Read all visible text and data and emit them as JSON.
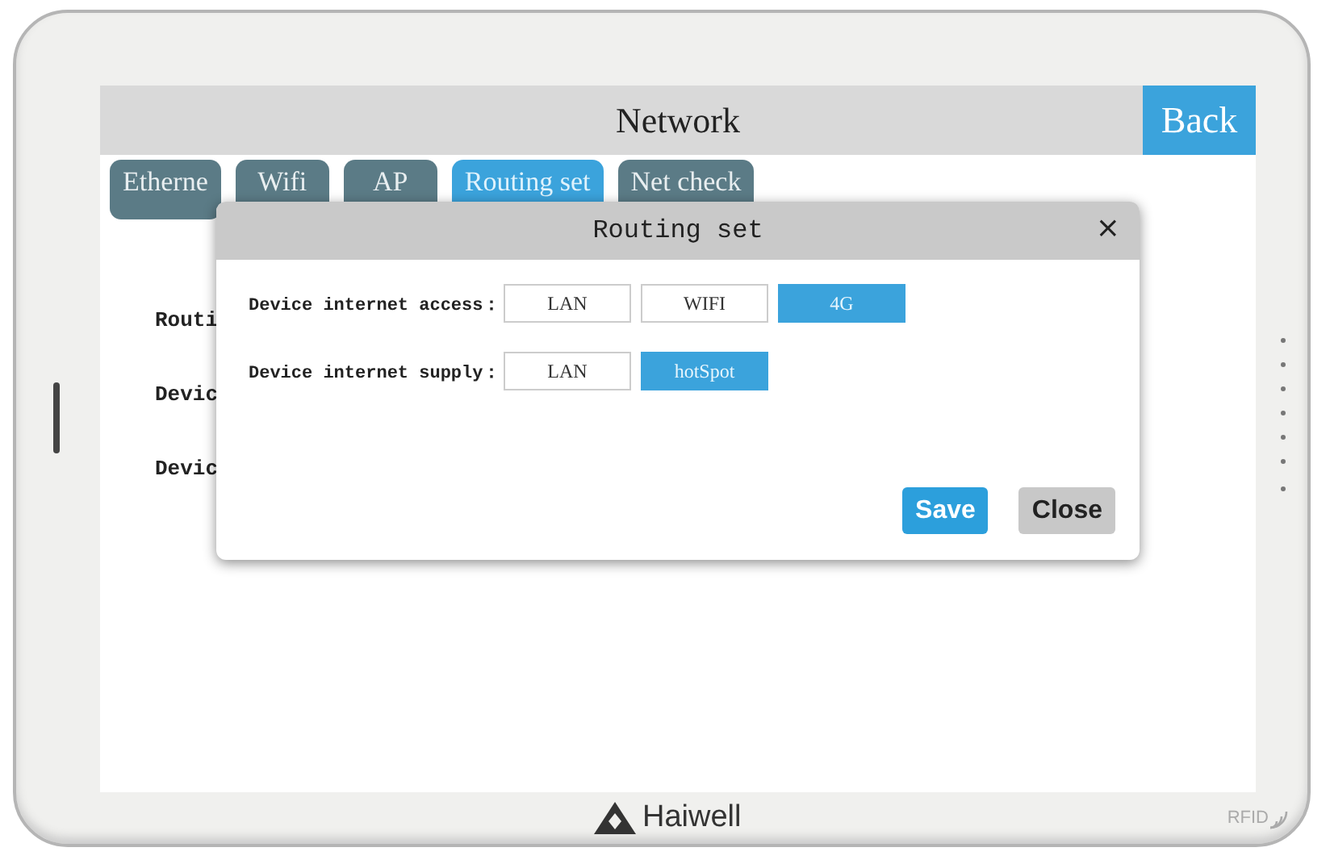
{
  "window": {
    "title": "Network",
    "back_button": "Back"
  },
  "tabs": [
    {
      "label": "Etherne",
      "selected": false
    },
    {
      "label": "Wifi",
      "selected": false
    },
    {
      "label": "AP",
      "selected": false
    },
    {
      "label": "Routing set",
      "selected": true
    },
    {
      "label": "Net check",
      "selected": false
    }
  ],
  "form_labels": [
    "Routi",
    "Devic",
    "Devic"
  ],
  "dialog": {
    "title": "Routing set",
    "close": "×",
    "rows": [
      {
        "label": "Device internet access：",
        "options": [
          {
            "label": "LAN",
            "selected": false
          },
          {
            "label": "WIFI",
            "selected": false
          },
          {
            "label": "4G",
            "selected": true
          }
        ]
      },
      {
        "label": "Device internet supply：",
        "options": [
          {
            "label": "LAN",
            "selected": false
          },
          {
            "label": "hotSpot",
            "selected": true
          }
        ]
      }
    ],
    "buttons": [
      {
        "label": "Save",
        "kind": "primary"
      },
      {
        "label": "Close",
        "kind": "secondary"
      }
    ]
  },
  "bezel": {
    "brand": "Haiwell",
    "badge": "RFID"
  }
}
